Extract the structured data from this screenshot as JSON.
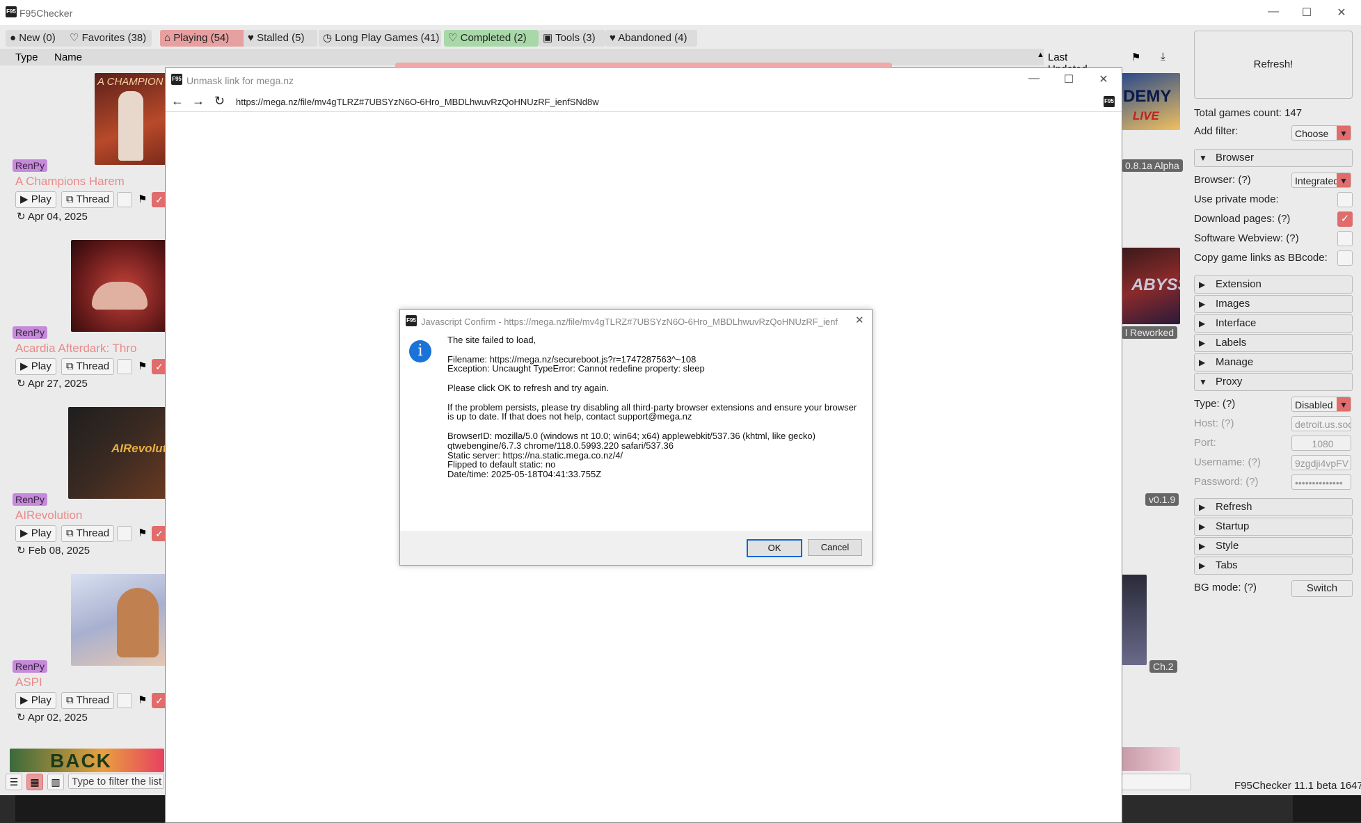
{
  "main_window": {
    "title": "F95Checker",
    "app_icon": "F95",
    "controls": {
      "minimize": "—",
      "maximize": "☐",
      "close": "✕"
    }
  },
  "tabs": [
    {
      "icon": "●",
      "label": "New (0)"
    },
    {
      "icon": "♡",
      "label": "Favorites (38)"
    },
    {
      "icon": "⌂",
      "label": "Playing (54)"
    },
    {
      "icon": "♥",
      "label": "Stalled (5)"
    },
    {
      "icon": "◷",
      "label": "Long Play Games (41)"
    },
    {
      "icon": "♡",
      "label": "Completed (2)"
    },
    {
      "icon": "▣",
      "label": "Tools (3)"
    },
    {
      "icon": "♥",
      "label": "Abandoned (4)"
    }
  ],
  "columns": {
    "type": "Type",
    "name": "Name",
    "last_updated": "Last Updated",
    "sort_arrow": "▲",
    "flag": "⚑",
    "download": "⤓"
  },
  "games": [
    {
      "engine": "RenPy",
      "title": "A Champions Harem",
      "date": "Apr 04, 2025",
      "thumb_text": "A CHAMPION"
    },
    {
      "engine": "RenPy",
      "title": "Acardia Afterdark: Thro",
      "date": "Apr 27, 2025",
      "thumb_text": ""
    },
    {
      "engine": "RenPy",
      "title": "AIRevolution",
      "date": "Feb 08, 2025",
      "thumb_text": "AIRevolut"
    },
    {
      "engine": "RenPy",
      "title": "ASPI",
      "date": "Apr 02, 2025",
      "thumb_text": ""
    }
  ],
  "game_buttons": {
    "play": "Play",
    "thread": "Thread",
    "play_icon": "▶",
    "thread_icon": "⧉",
    "flag_icon": "⚑",
    "check": "✓",
    "clock_icon": "↻"
  },
  "right_cards": [
    {
      "thumb_text": "DEMY\nLIVE",
      "version": "0.8.1a Alpha"
    },
    {
      "thumb_text": "ABYSS",
      "version": "l Reworked"
    },
    {
      "thumb_text": "",
      "version": "v0.1.9"
    },
    {
      "thumb_text": "",
      "version": "Ch.2"
    }
  ],
  "bottom_bar": {
    "filter_placeholder": "Type to filter the list",
    "version": "F95Checker 11.1 beta 1647"
  },
  "sidebar": {
    "refresh": "Refresh!",
    "total_games": "Total games count: 147",
    "add_filter_label": "Add filter:",
    "add_filter_value": "Choose",
    "sections": {
      "browser": "Browser",
      "extension": "Extension",
      "images": "Images",
      "interface": "Interface",
      "labels": "Labels",
      "manage": "Manage",
      "proxy": "Proxy",
      "refresh": "Refresh",
      "startup": "Startup",
      "style": "Style",
      "tabs": "Tabs"
    },
    "browser_settings": {
      "browser_label": "Browser: (?)",
      "browser_value": "Integrated",
      "private_mode": "Use private mode:",
      "download_pages": "Download pages: (?)",
      "software_webview": "Software Webview: (?)",
      "copy_bbcode": "Copy game links as BBcode:"
    },
    "proxy_settings": {
      "type_label": "Type: (?)",
      "type_value": "Disabled",
      "host_label": "Host: (?)",
      "host_value": "detroit.us.socks.nordhold.net",
      "port_label": "Port:",
      "port_value": "1080",
      "username_label": "Username: (?)",
      "username_value": "9zgdji4vpFV",
      "password_label": "Password: (?)",
      "password_value": "••••••••••••••"
    },
    "bg_mode_label": "BG mode: (?)",
    "bg_mode_button": "Switch"
  },
  "browser_window": {
    "title": "Unmask link for mega.nz",
    "url": "https://mega.nz/file/mv4gTLRZ#7UBSYzN6O-6Hro_MBDLhwuvRzQoHNUzRF_ienfSNd8w",
    "nav": {
      "back": "←",
      "forward": "→",
      "reload": "↻"
    }
  },
  "dialog": {
    "title": "Javascript Confirm - https://mega.nz/file/mv4gTLRZ#7UBSYzN6O-6Hro_MBDLhwuvRzQoHNUzRF_ienfS...",
    "icon": "i",
    "lines": [
      "The site failed to load,",
      "",
      "Filename: https://mega.nz/secureboot.js?r=1747287563^~108",
      "Exception: Uncaught TypeError: Cannot redefine property: sleep",
      "",
      "Please click OK to refresh and try again.",
      "",
      "If the problem persists, please try disabling all third-party browser extensions and ensure your browser",
      "is up to date. If that does not help, contact support@mega.nz",
      "",
      "BrowserID: mozilla/5.0 (windows nt 10.0; win64; x64) applewebkit/537.36 (khtml, like gecko)",
      "qtwebengine/6.7.3 chrome/118.0.5993.220 safari/537.36",
      "Static server: https://na.static.mega.co.nz/4/",
      "Flipped to default static: no",
      "Date/time: 2025-05-18T04:41:33.755Z"
    ],
    "ok": "OK",
    "cancel": "Cancel",
    "close": "✕"
  }
}
